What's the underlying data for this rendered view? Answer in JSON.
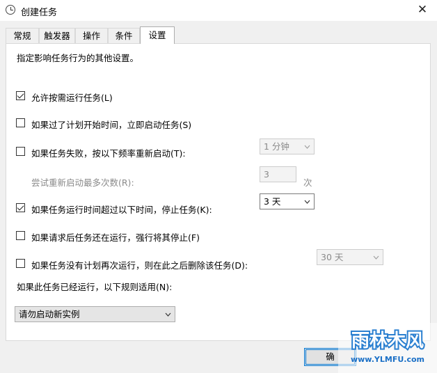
{
  "window": {
    "title": "创建任务",
    "close_glyph": "✕"
  },
  "tabs": [
    {
      "label": "常规"
    },
    {
      "label": "触发器"
    },
    {
      "label": "操作"
    },
    {
      "label": "条件"
    },
    {
      "label": "设置",
      "active": true
    }
  ],
  "settings": {
    "description": "指定影响任务行为的其他设置。",
    "allow_on_demand": {
      "label": "允许按需运行任务(L)",
      "checked": true
    },
    "run_if_missed": {
      "label": "如果过了计划开始时间，立即启动任务(S)",
      "checked": false
    },
    "restart_on_fail": {
      "label": "如果任务失败，按以下频率重新启动(T):",
      "checked": false,
      "interval": "1 分钟"
    },
    "restart_attempts": {
      "label": "尝试重新启动最多次数(R):",
      "value": "3",
      "unit": "次"
    },
    "stop_if_longer": {
      "label": "如果任务运行时间超过以下时间，停止任务(K):",
      "checked": true,
      "duration": "3 天"
    },
    "force_stop": {
      "label": "如果请求后任务还在运行，强行将其停止(F)",
      "checked": false
    },
    "delete_if_not_scheduled": {
      "label": "如果任务没有计划再次运行，则在此之后删除该任务(D):",
      "checked": false,
      "after": "30 天"
    },
    "running_rule_label": "如果此任务已经运行，以下规则适用(N):",
    "running_rule_value": "请勿启动新实例"
  },
  "footer": {
    "ok_label": "确"
  },
  "watermark": {
    "brand": "雨林木风",
    "url": "www.YLMFU.com"
  }
}
